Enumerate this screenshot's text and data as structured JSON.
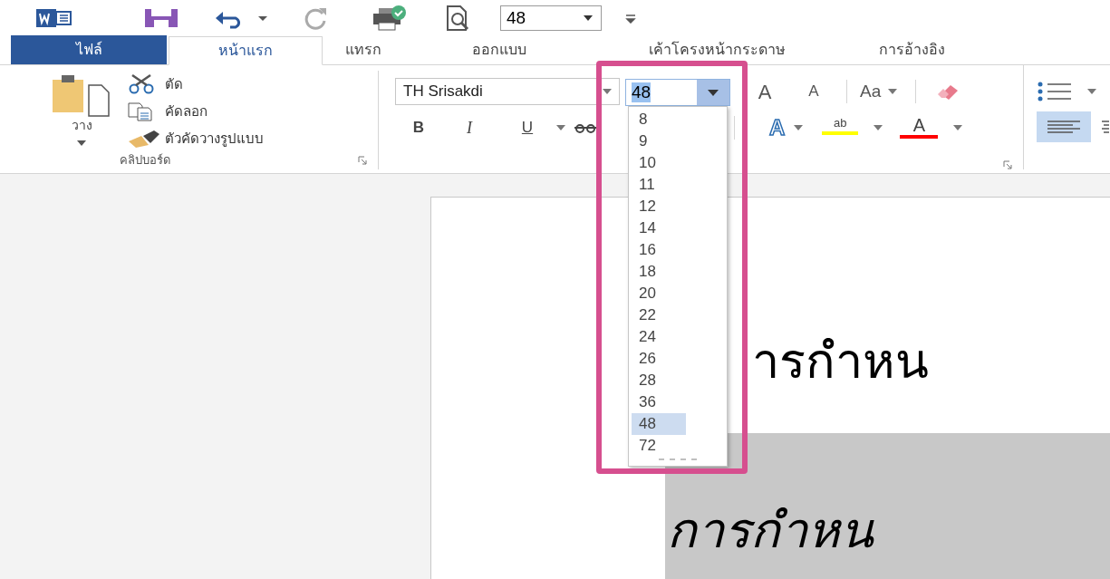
{
  "quick_access": {
    "font_size": "48"
  },
  "tabs": [
    {
      "label": "ไฟล์",
      "kind": "file",
      "selected": false
    },
    {
      "label": "หน้าแรก",
      "kind": "tab",
      "selected": true
    },
    {
      "label": "แทรก",
      "kind": "tab",
      "selected": false
    },
    {
      "label": "ออกแบบ",
      "kind": "tab",
      "selected": false
    },
    {
      "label": "เค้าโครงหน้ากระดาษ",
      "kind": "tab",
      "selected": false
    },
    {
      "label": "การอ้างอิง",
      "kind": "tab",
      "selected": false
    }
  ],
  "clipboard": {
    "paste": "วาง",
    "items": [
      {
        "label": "ตัด",
        "kind": "cut"
      },
      {
        "label": "คัดลอก",
        "kind": "copy"
      },
      {
        "label": "ตัวคัดวางรูปแบบ",
        "kind": "painter"
      }
    ],
    "group_label": "คลิปบอร์ด"
  },
  "font": {
    "name": "TH Srisakdi",
    "size": "48",
    "grow": "A",
    "shrink": "A",
    "change_case": "Aa",
    "bold": "B",
    "italic": "I",
    "underline": "U",
    "text_effects": "A",
    "highlight": "ab",
    "font_color": "A"
  },
  "size_list": [
    {
      "label": "8",
      "selected": false
    },
    {
      "label": "9",
      "selected": false
    },
    {
      "label": "10",
      "selected": false
    },
    {
      "label": "11",
      "selected": false
    },
    {
      "label": "12",
      "selected": false
    },
    {
      "label": "14",
      "selected": false
    },
    {
      "label": "16",
      "selected": false
    },
    {
      "label": "18",
      "selected": false
    },
    {
      "label": "20",
      "selected": false
    },
    {
      "label": "22",
      "selected": false
    },
    {
      "label": "24",
      "selected": false
    },
    {
      "label": "26",
      "selected": false
    },
    {
      "label": "28",
      "selected": false
    },
    {
      "label": "36",
      "selected": false
    },
    {
      "label": "48",
      "selected": true
    },
    {
      "label": "72",
      "selected": false
    }
  ],
  "paragraph": {
    "align_left_selected": true
  },
  "document": {
    "lines": [
      {
        "text": "ารกำหน",
        "italic": false,
        "shaded": false
      },
      {
        "text": "การกำหน",
        "italic": true,
        "shaded": true
      }
    ]
  }
}
